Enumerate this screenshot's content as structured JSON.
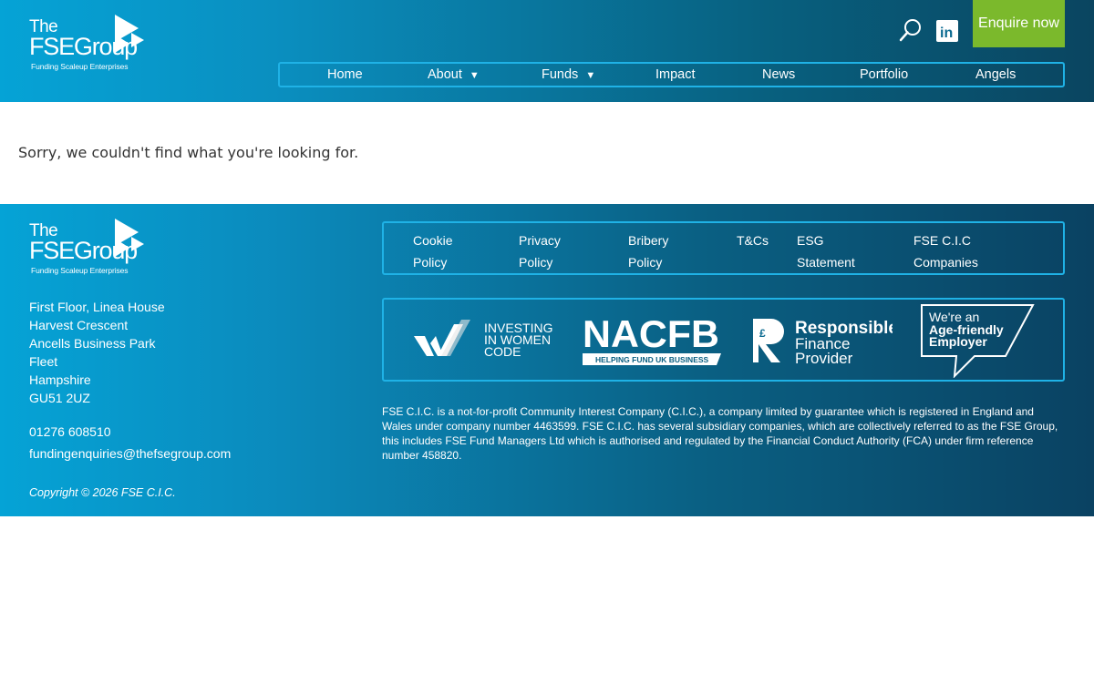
{
  "header": {
    "logo": {
      "the": "The",
      "brand": "FSEGroup",
      "tagline": "Funding Scaleup Enterprises"
    },
    "search_icon": "search-icon",
    "social_icon": "linkedin-icon",
    "social_label": "in",
    "enquire_label": "Enquire now",
    "accent_color": "#7bb92c"
  },
  "nav": {
    "items": [
      {
        "label": "Home"
      },
      {
        "label": "About",
        "caret": "▼"
      },
      {
        "label": "Funds",
        "caret": "▼"
      },
      {
        "label": "Impact"
      },
      {
        "label": "News"
      },
      {
        "label": "Portfolio"
      },
      {
        "label": "Angels"
      }
    ]
  },
  "content": {
    "message": "Sorry, we couldn't find what you're looking for."
  },
  "footer": {
    "logo": {
      "the": "The",
      "brand": "FSEGroup",
      "tagline": "Funding Scaleup Enterprises"
    },
    "address_lines": [
      "First Floor, Linea House",
      "Harvest Crescent",
      "Ancells Business Park",
      "Fleet",
      "Hampshire",
      "GU51 2UZ"
    ],
    "phone": "01276 608510",
    "email": "fundingenquiries@thefsegroup.com",
    "copyright": "Copyright © 2026 FSE C.I.C.",
    "links": [
      {
        "line1": "Cookie",
        "line2": "Policy"
      },
      {
        "line1": "Privacy",
        "line2": "Policy"
      },
      {
        "line1": "Bribery",
        "line2": "Policy"
      },
      {
        "line1": "T&Cs",
        "line2": ""
      },
      {
        "line1": "ESG",
        "line2": "Statement"
      },
      {
        "line1": "FSE C.I.C",
        "line2": "Companies"
      }
    ],
    "badges": {
      "iwic": {
        "line1": "INVESTING",
        "line2": "IN WOMEN",
        "line3": "CODE"
      },
      "nacfb": {
        "title": "NACFB",
        "subtitle": "HELPING FUND UK BUSINESS"
      },
      "rfp": {
        "line1": "Responsible",
        "line2": "Finance",
        "line3": "Provider"
      },
      "age": {
        "line1": "We're an",
        "line2": "Age-friendly",
        "line3": "Employer"
      }
    },
    "legal": "FSE C.I.C. is a not-for-profit Community Interest Company (C.I.C.), a company limited by guarantee which is registered in England and Wales under company number 4463599. FSE C.I.C. has several subsidiary companies, which are collectively referred to as the FSE Group, this includes FSE Fund Managers Ltd which is authorised and regulated by the Financial Conduct Authority (FCA) under firm reference number 458820."
  }
}
